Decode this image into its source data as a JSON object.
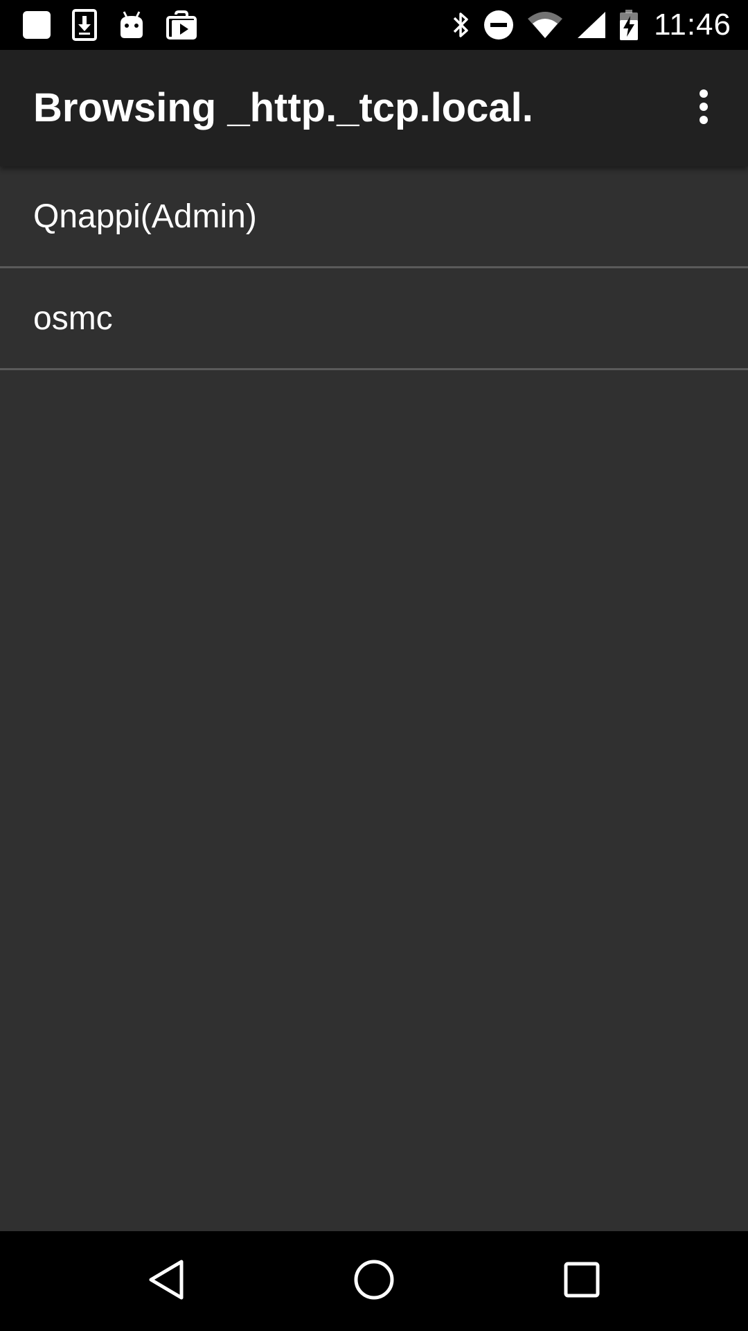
{
  "status_bar": {
    "time": "11:46",
    "left_icons": [
      "blank-square-icon",
      "download-icon",
      "android-icon",
      "video-store-icon"
    ],
    "right_icons": [
      "bluetooth-icon",
      "do-not-disturb-icon",
      "wifi-icon",
      "cell-signal-icon",
      "battery-charging-icon"
    ]
  },
  "app_bar": {
    "title": "Browsing _http._tcp.local.",
    "overflow_icon": "more-vert-icon"
  },
  "services": [
    {
      "label": "Qnappi(Admin)"
    },
    {
      "label": "osmc"
    }
  ],
  "nav_bar": {
    "icons": [
      "back-icon",
      "home-icon",
      "recents-icon"
    ]
  },
  "colors": {
    "background": "#303030",
    "app_bar": "#212121",
    "status_bar": "#000000",
    "divider": "#5a5a5a",
    "text": "#ffffff"
  }
}
